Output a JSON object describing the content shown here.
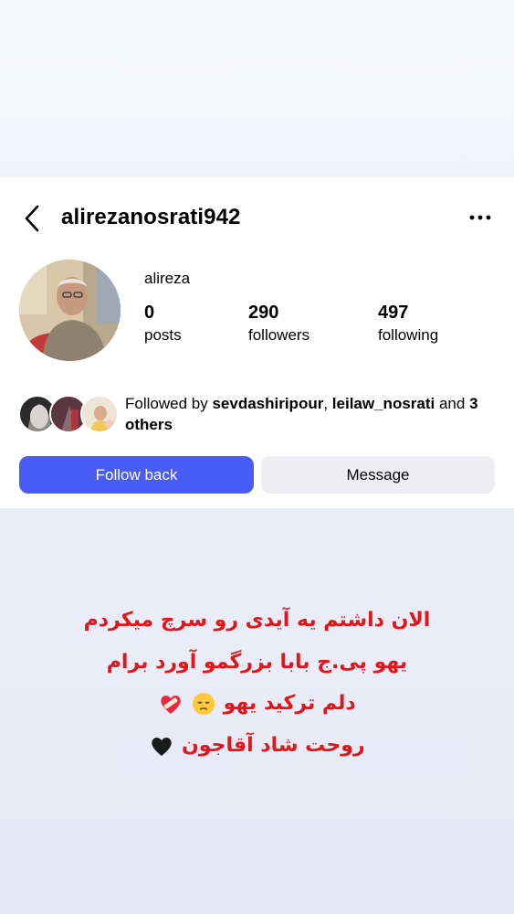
{
  "profile": {
    "username": "alirezanosrati942",
    "display_name": "alireza",
    "stats": [
      {
        "value": "0",
        "label": "posts"
      },
      {
        "value": "290",
        "label": "followers"
      },
      {
        "value": "497",
        "label": "following"
      }
    ],
    "followed_by": {
      "prefix": "Followed by",
      "user1": "sevdashiripour",
      "separator": ",",
      "user2": "leilaw_nosrati",
      "conjunction": "and",
      "others": "3 others"
    },
    "buttons": {
      "follow_back": "Follow back",
      "message": "Message"
    }
  },
  "caption": {
    "line1": "الان داشتم یه آیدی رو سرچ میکردم",
    "line2": "یهو پی.ج بابا بزرگمو آورد برام",
    "line3": "دلم ترکید یهو",
    "line4": "روحت شاد آقاجون"
  },
  "colors": {
    "accent": "#4a5cf6",
    "caption": "#e0161b",
    "message_button": "#efeff3"
  }
}
